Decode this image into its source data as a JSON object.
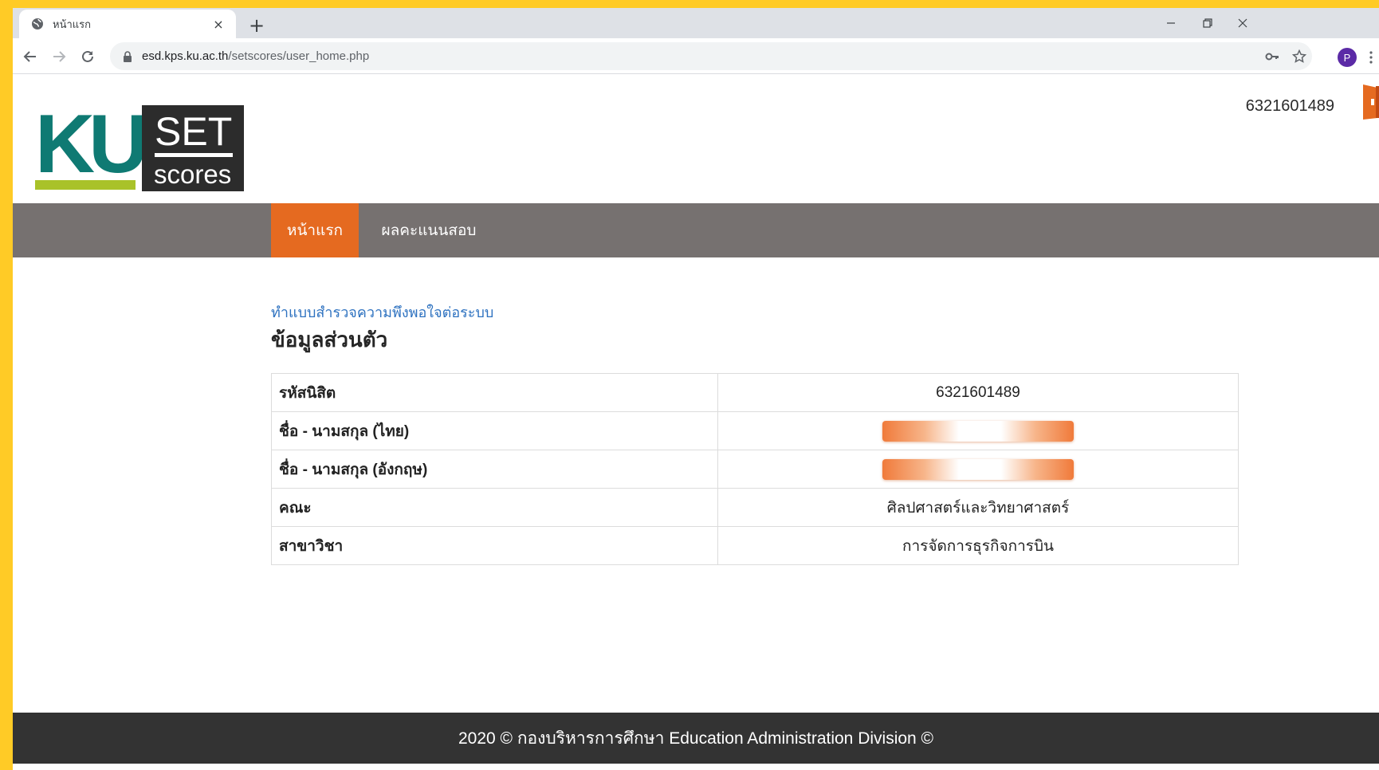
{
  "browser": {
    "tab_title": "หน้าแรก",
    "tab_close": "×",
    "new_tab": "+",
    "url_host": "esd.kps.ku.ac.th",
    "url_path": "/setscores/user_home.php",
    "profile_initial": "P"
  },
  "header": {
    "logo": {
      "left_text": "KU",
      "right_top": "SET",
      "right_bottom": "scores",
      "colors": {
        "teal": "#0f7a73",
        "green": "#a9c229",
        "box": "#2c2c2c"
      }
    },
    "student_id": "6321601489"
  },
  "nav": {
    "items": [
      {
        "label": "หน้าแรก",
        "active": true
      },
      {
        "label": "ผลคะแนนสอบ",
        "active": false
      }
    ],
    "colors": {
      "bar": "#767170",
      "active": "#e56a20"
    }
  },
  "main": {
    "survey_link": "ทำแบบสำรวจความพึงพอใจต่อระบบ",
    "section_title": "ข้อมูลส่วนตัว",
    "rows": [
      {
        "label": "รหัสนิสิต",
        "value": "6321601489"
      },
      {
        "label": "ชื่อ - นามสกุล (ไทย)",
        "value": ""
      },
      {
        "label": "ชื่อ - นามสกุล (อังกฤษ)",
        "value": ""
      },
      {
        "label": "คณะ",
        "value": "ศิลปศาสตร์และวิทยาศาสตร์"
      },
      {
        "label": "สาขาวิชา",
        "value": "การจัดการธุรกิจการบิน"
      }
    ]
  },
  "footer": {
    "text": "2020 © กองบริหารการศึกษา Education Administration Division ©"
  }
}
